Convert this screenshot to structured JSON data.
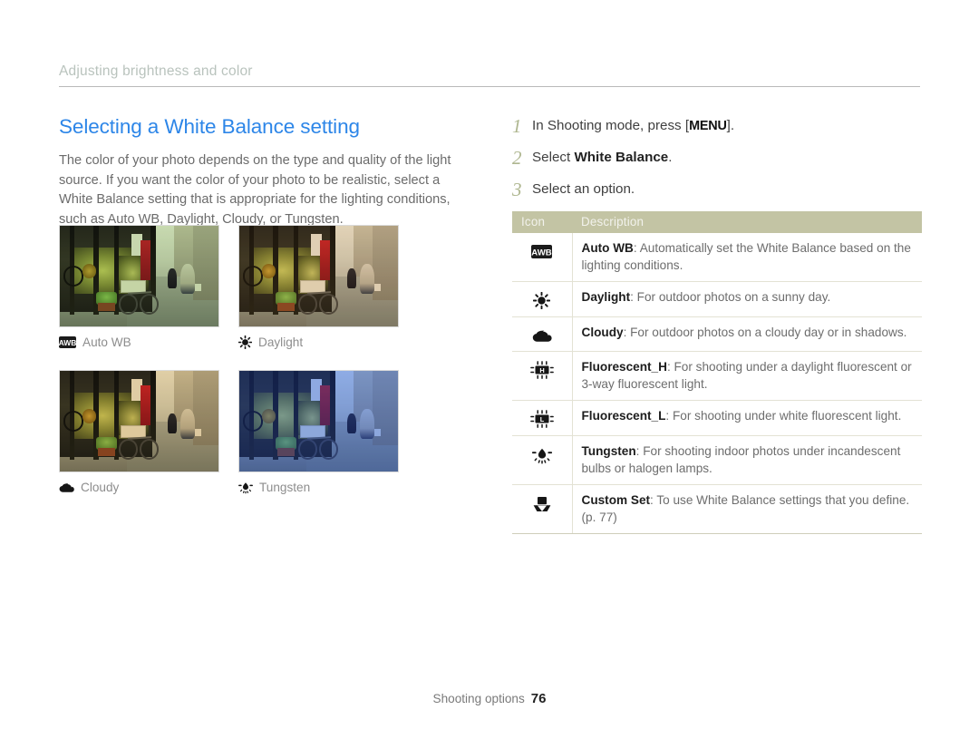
{
  "header": {
    "running_title": "Adjusting brightness and color"
  },
  "left": {
    "title": "Selecting a White Balance setting",
    "intro": "The color of your photo depends on the type and quality of the light source. If you want the color of your photo to be realistic, select a White Balance setting that is appropriate for the lighting conditions, such as Auto WB, Daylight, Cloudy, or Tungsten.",
    "samples": [
      {
        "caption": "Auto WB",
        "icon": "awb-badge-icon"
      },
      {
        "caption": "Daylight",
        "icon": "sun-icon"
      },
      {
        "caption": "Cloudy",
        "icon": "cloud-icon"
      },
      {
        "caption": "Tungsten",
        "icon": "bulb-icon"
      }
    ]
  },
  "right": {
    "steps": [
      {
        "num": "1",
        "prefix": "In Shooting mode, press [",
        "key": "MENU",
        "suffix": "]."
      },
      {
        "num": "2",
        "prefix": "Select ",
        "bold": "White Balance",
        "suffix": "."
      },
      {
        "num": "3",
        "prefix": "Select an option.",
        "bold": "",
        "suffix": ""
      }
    ],
    "table": {
      "columns": [
        "Icon",
        "Description"
      ],
      "rows": [
        {
          "icon": "awb-badge-icon",
          "name": "Auto WB",
          "desc": ": Automatically set the White Balance based on the lighting conditions."
        },
        {
          "icon": "sun-icon",
          "name": "Daylight",
          "desc": ": For outdoor photos on a sunny day."
        },
        {
          "icon": "cloud-icon",
          "name": "Cloudy",
          "desc": ": For outdoor photos on a cloudy day or in shadows."
        },
        {
          "icon": "fluorescent-h-icon",
          "name": "Fluorescent_H",
          "desc": ": For shooting under a daylight fluorescent or 3-way fluorescent light."
        },
        {
          "icon": "fluorescent-l-icon",
          "name": "Fluorescent_L",
          "desc": ": For shooting under white fluorescent light."
        },
        {
          "icon": "bulb-icon",
          "name": "Tungsten",
          "desc": ": For shooting indoor photos under incandescent bulbs or halogen lamps."
        },
        {
          "icon": "custom-set-icon",
          "name": "Custom Set",
          "desc": ": To use White Balance settings that you define. (p. 77)"
        }
      ]
    }
  },
  "footer": {
    "section": "Shooting options",
    "page": "76"
  },
  "colors": {
    "title_blue": "#2d86e8",
    "step_number_green": "#aeb68f",
    "table_header_bg": "#c3c4a4",
    "running_head": "#b9c3bd",
    "body_text": "#6b6b6b"
  }
}
